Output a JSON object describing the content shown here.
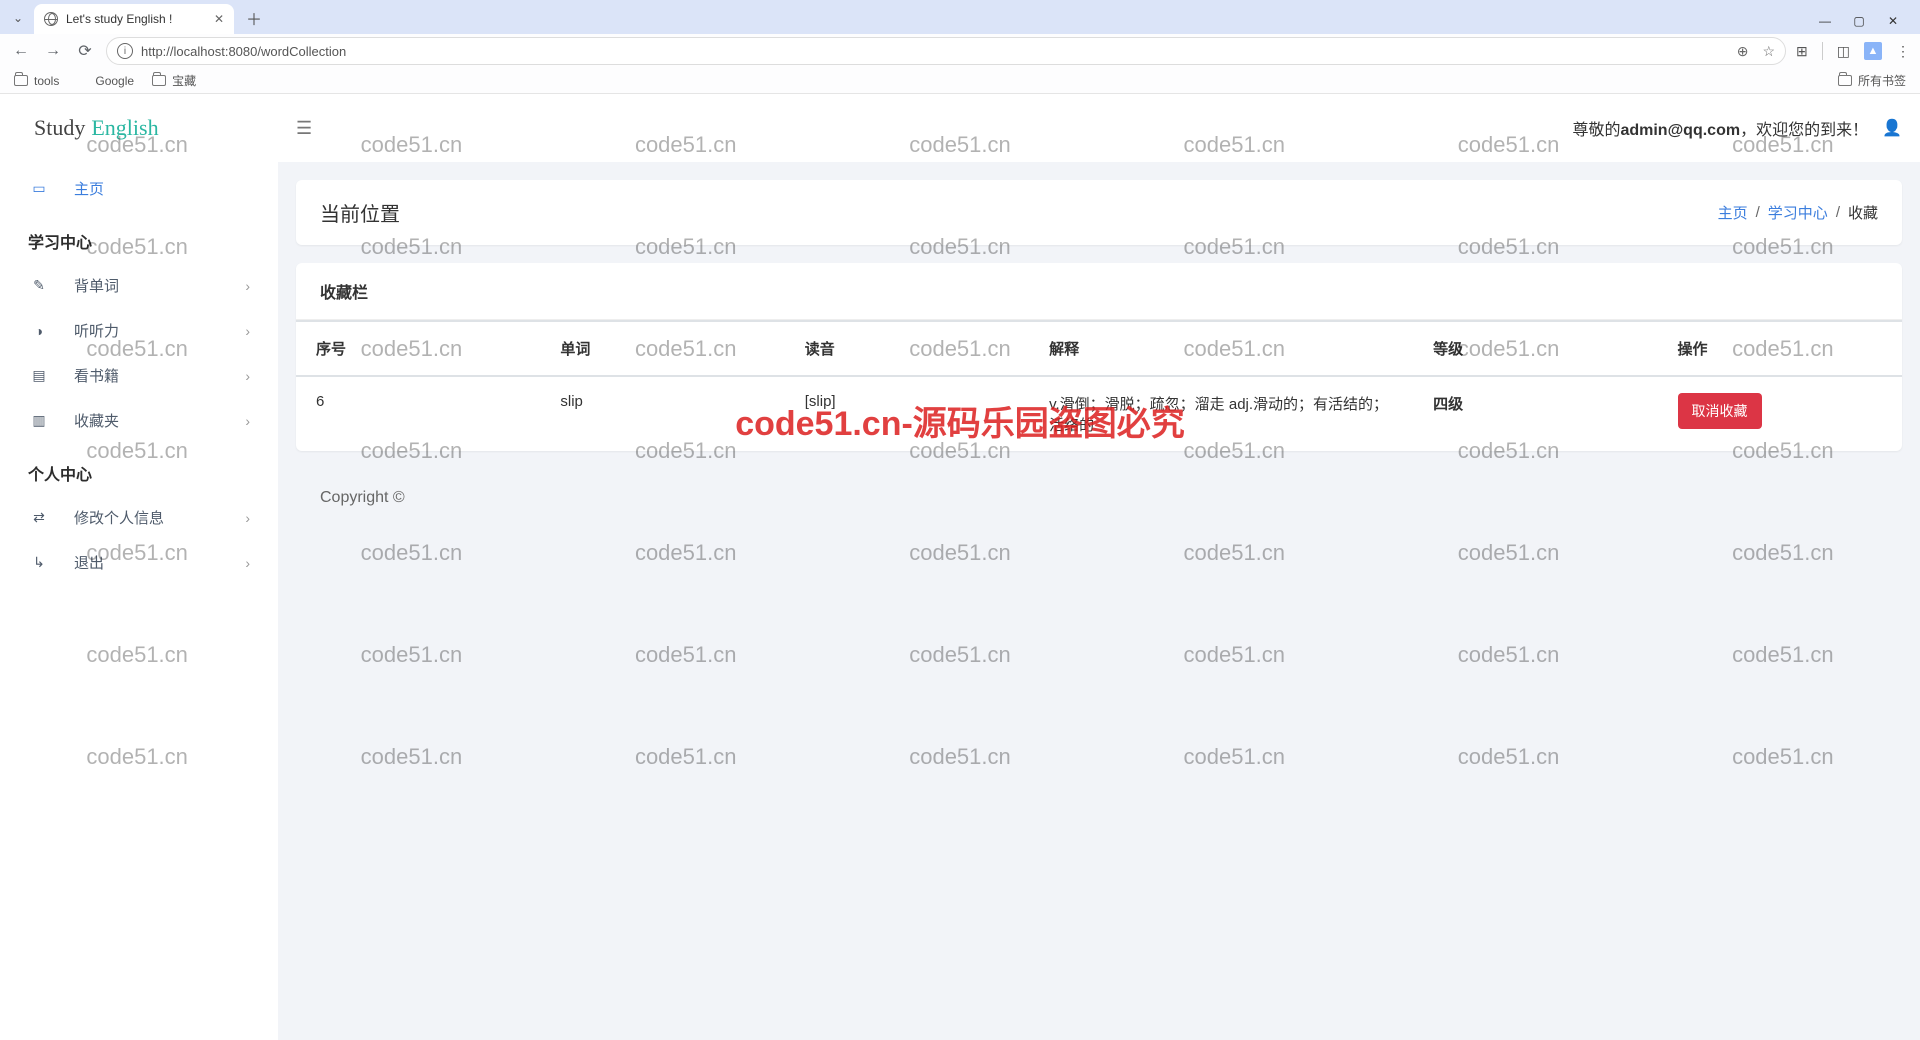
{
  "browser": {
    "tab_title": "Let's study English !",
    "url": "http://localhost:8080/wordCollection",
    "bookmarks": [
      "tools",
      "Google",
      "宝藏"
    ],
    "all_bookmarks": "所有书签"
  },
  "logo": {
    "left": "Study",
    "right": "English"
  },
  "sidebar": {
    "home": "主页",
    "study_heading": "学习中心",
    "items_study": [
      {
        "label": "背单词"
      },
      {
        "label": "听听力"
      },
      {
        "label": "看书籍"
      },
      {
        "label": "收藏夹"
      }
    ],
    "personal_heading": "个人中心",
    "items_personal": [
      {
        "label": "修改个人信息"
      },
      {
        "label": "退出"
      }
    ]
  },
  "topbar": {
    "greeting_prefix": "尊敬的",
    "user": "admin@qq.com",
    "greeting_suffix": "，欢迎您的到来！"
  },
  "location": {
    "title": "当前位置",
    "crumbs": [
      "主页",
      "学习中心",
      "收藏"
    ]
  },
  "collection": {
    "title": "收藏栏",
    "headers": {
      "id": "序号",
      "word": "单词",
      "pron": "读音",
      "trans": "解释",
      "level": "等级",
      "action": "操作"
    },
    "rows": [
      {
        "id": "6",
        "word": "slip",
        "pron": "[slip]",
        "trans": "v.滑倒；滑脱；疏忽；溜走 adj.滑动的；有活结的；活络的",
        "level": "四级",
        "action": "取消收藏"
      }
    ]
  },
  "footer": "Copyright ©",
  "watermark": {
    "small": "code51.cn",
    "big": "code51.cn-源码乐园盗图必究"
  }
}
